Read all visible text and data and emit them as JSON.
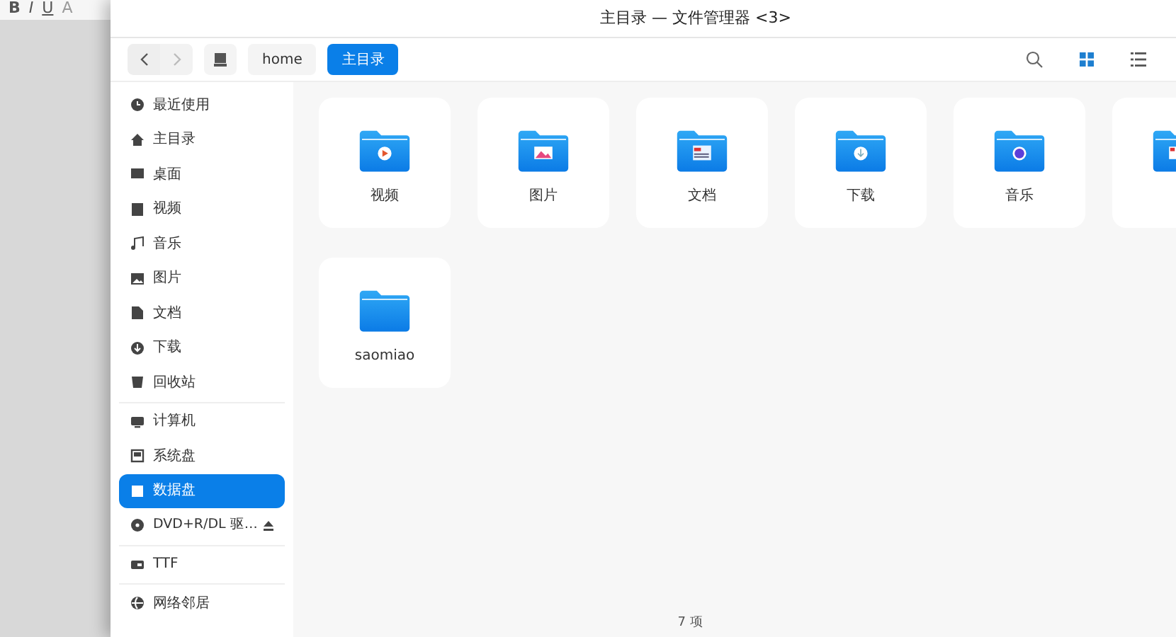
{
  "editor_toolbar": [
    {
      "label": "B",
      "kind": "bold"
    },
    {
      "label": "I",
      "kind": "italic"
    },
    {
      "label": "U",
      "kind": "underline"
    },
    {
      "label": "A",
      "kind": "color"
    }
  ],
  "window": {
    "title": "主目录 — 文件管理器 <3>"
  },
  "toolbar": {
    "breadcrumbs": [
      {
        "label": "home",
        "selected": false
      },
      {
        "label": "主目录",
        "selected": true
      }
    ],
    "views": [
      {
        "kind": "grid",
        "selected": true
      },
      {
        "kind": "list",
        "selected": false
      }
    ]
  },
  "sidebar": {
    "groups": [
      [
        {
          "label": "最近使用",
          "kind": "recent",
          "selected": false
        },
        {
          "label": "主目录",
          "kind": "home",
          "selected": false
        },
        {
          "label": "桌面",
          "kind": "desktop",
          "selected": false
        },
        {
          "label": "视频",
          "kind": "video",
          "selected": false
        },
        {
          "label": "音乐",
          "kind": "music",
          "selected": false
        },
        {
          "label": "图片",
          "kind": "picture",
          "selected": false
        },
        {
          "label": "文档",
          "kind": "document",
          "selected": false
        },
        {
          "label": "下载",
          "kind": "download",
          "selected": false
        },
        {
          "label": "回收站",
          "kind": "trash",
          "selected": false
        }
      ],
      [
        {
          "label": "计算机",
          "kind": "computer",
          "selected": false
        },
        {
          "label": "系统盘",
          "kind": "disk",
          "selected": false
        },
        {
          "label": "数据盘",
          "kind": "disk",
          "selected": true
        },
        {
          "label": "DVD+R/DL 驱…",
          "kind": "dvd",
          "selected": false,
          "ejectable": true
        }
      ],
      [
        {
          "label": "TTF",
          "kind": "drive",
          "selected": false
        }
      ],
      [
        {
          "label": "网络邻居",
          "kind": "network",
          "selected": false
        }
      ]
    ]
  },
  "files": [
    {
      "label": "视频",
      "kind": "video"
    },
    {
      "label": "图片",
      "kind": "picture"
    },
    {
      "label": "文档",
      "kind": "document"
    },
    {
      "label": "下载",
      "kind": "download"
    },
    {
      "label": "音乐",
      "kind": "music"
    },
    {
      "kind": "desktop"
    },
    {
      "label": "saomiao",
      "kind": "plain"
    }
  ],
  "status_bar": "7 项"
}
